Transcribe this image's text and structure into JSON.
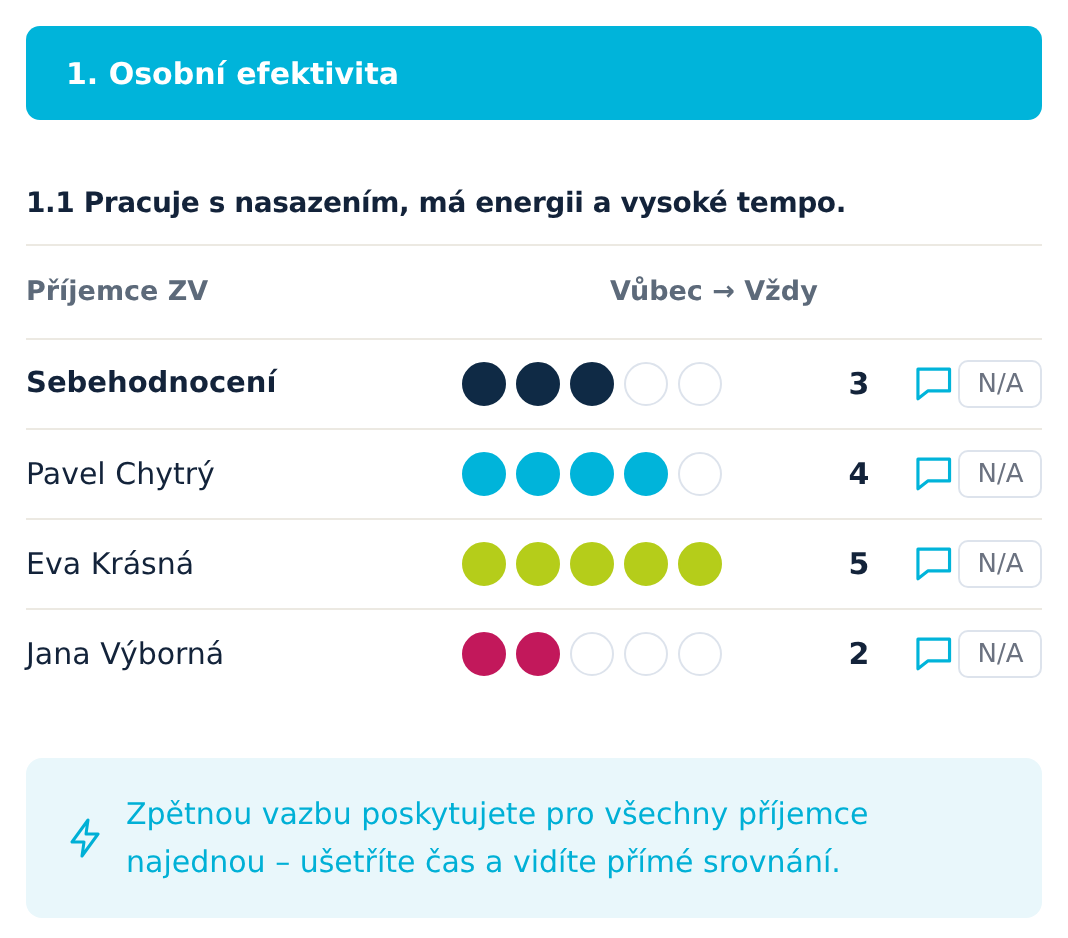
{
  "section": {
    "title": "1. Osobní efektivita"
  },
  "question": "1.1 Pracuje s nasazením, má energii a vysoké tempo.",
  "columns": {
    "recipient": "Příjemce ZV",
    "scale": "Vůbec → Vždy"
  },
  "rows": [
    {
      "kind": "self",
      "name": "Sebehodnocení",
      "stars": 3,
      "color": "#0f2a45",
      "score": "3",
      "na": "N/A"
    },
    {
      "kind": "recipient",
      "name": "Pavel Chytrý",
      "stars": 4,
      "color": "#00b4da",
      "score": "4",
      "na": "N/A"
    },
    {
      "kind": "recipient",
      "name": "Eva Krásná",
      "stars": 5,
      "color": "#b5cd1a",
      "score": "5",
      "na": "N/A"
    },
    {
      "kind": "recipient",
      "name": "Jana Výborná",
      "stars": 2,
      "color": "#c2185b",
      "score": "2",
      "na": "N/A"
    }
  ],
  "info": "Zpětnou vazbu poskytujete pro všechny příjemce najednou – ušetříte čas a vidíte přímé srovnání."
}
